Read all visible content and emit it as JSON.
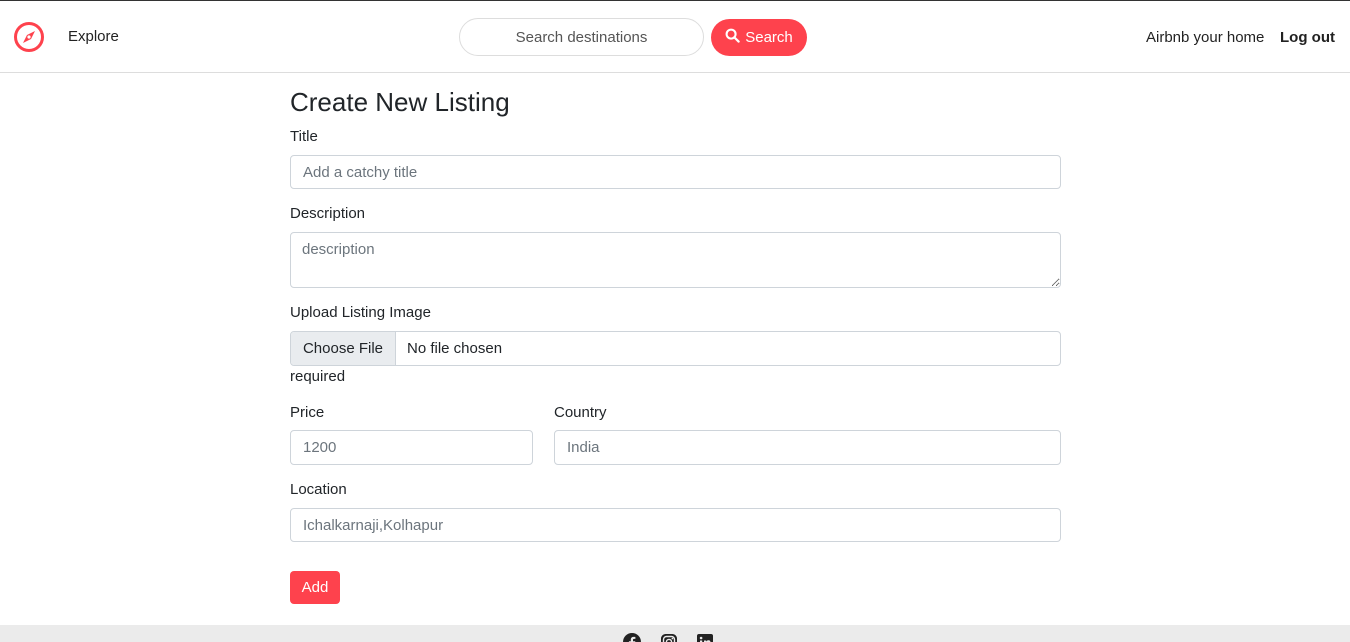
{
  "navbar": {
    "logo_icon": "compass-icon",
    "explore_label": "Explore",
    "search_placeholder": "Search destinations",
    "search_button_label": "Search",
    "search_icon": "search-icon",
    "host_label": "Airbnb your home",
    "logout_label": "Log out"
  },
  "form": {
    "title": "Create New Listing",
    "title_label": "Title",
    "title_placeholder": "Add a catchy title",
    "description_label": "Description",
    "description_placeholder": "description",
    "image_label": "Upload Listing Image",
    "file_button_label": "Choose File",
    "file_status": "No file chosen",
    "image_feedback": "required",
    "price_label": "Price",
    "price_placeholder": "1200",
    "country_label": "Country",
    "country_placeholder": "India",
    "location_label": "Location",
    "location_placeholder": "Ichalkarnaji,Kolhapur",
    "submit_label": "Add"
  },
  "footer": {
    "social_icons": [
      "facebook-icon",
      "instagram-icon",
      "linkedin-icon"
    ]
  },
  "colors": {
    "brand": "#fe424d",
    "border": "#ced4da",
    "footer_bg": "#ebebeb"
  }
}
